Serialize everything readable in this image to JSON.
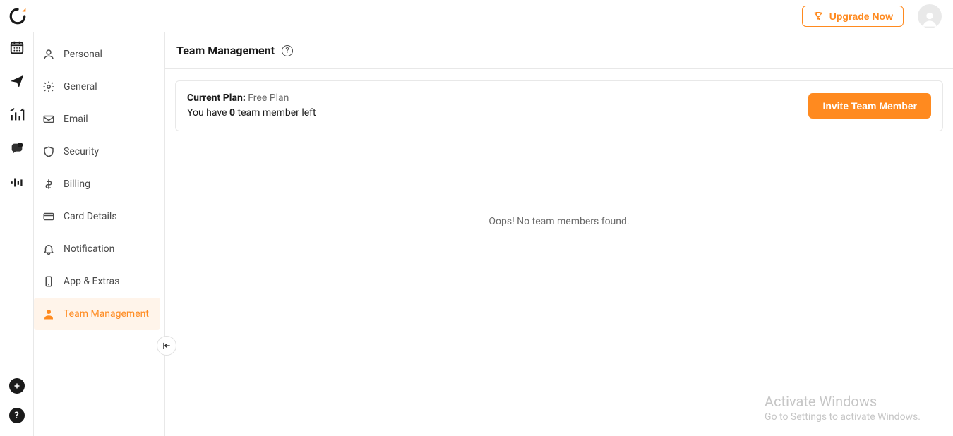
{
  "colors": {
    "accent": "#ff8a1f"
  },
  "header": {
    "upgrade_label": "Upgrade Now"
  },
  "rail": {
    "items": [
      {
        "name": "calendar-icon"
      },
      {
        "name": "send-icon"
      },
      {
        "name": "analytics-icon"
      },
      {
        "name": "chat-icon"
      },
      {
        "name": "audio-icon"
      }
    ],
    "add_name": "plus-icon",
    "help_name": "help-icon"
  },
  "sidebar": {
    "items": [
      {
        "label": "Personal",
        "name": "sidebar-item-personal",
        "icon": "person-icon",
        "active": false
      },
      {
        "label": "General",
        "name": "sidebar-item-general",
        "icon": "gear-icon",
        "active": false
      },
      {
        "label": "Email",
        "name": "sidebar-item-email",
        "icon": "mail-icon",
        "active": false
      },
      {
        "label": "Security",
        "name": "sidebar-item-security",
        "icon": "shield-icon",
        "active": false
      },
      {
        "label": "Billing",
        "name": "sidebar-item-billing",
        "icon": "dollar-icon",
        "active": false
      },
      {
        "label": "Card Details",
        "name": "sidebar-item-card-details",
        "icon": "card-icon",
        "active": false
      },
      {
        "label": "Notification",
        "name": "sidebar-item-notification",
        "icon": "bell-icon",
        "active": false
      },
      {
        "label": "App & Extras",
        "name": "sidebar-item-app-extras",
        "icon": "phone-icon",
        "active": false
      },
      {
        "label": "Team Management",
        "name": "sidebar-item-team-management",
        "icon": "person-solid-icon",
        "active": true
      }
    ]
  },
  "page": {
    "title": "Team Management",
    "help_char": "?"
  },
  "plan": {
    "current_plan_label": "Current Plan:",
    "current_plan_value": "Free Plan",
    "remaining_prefix": "You have",
    "remaining_count": "0",
    "remaining_suffix": "team member left",
    "invite_label": "Invite Team Member"
  },
  "empty": {
    "message": "Oops! No team members found."
  },
  "watermark": {
    "title": "Activate Windows",
    "subtitle": "Go to Settings to activate Windows."
  }
}
